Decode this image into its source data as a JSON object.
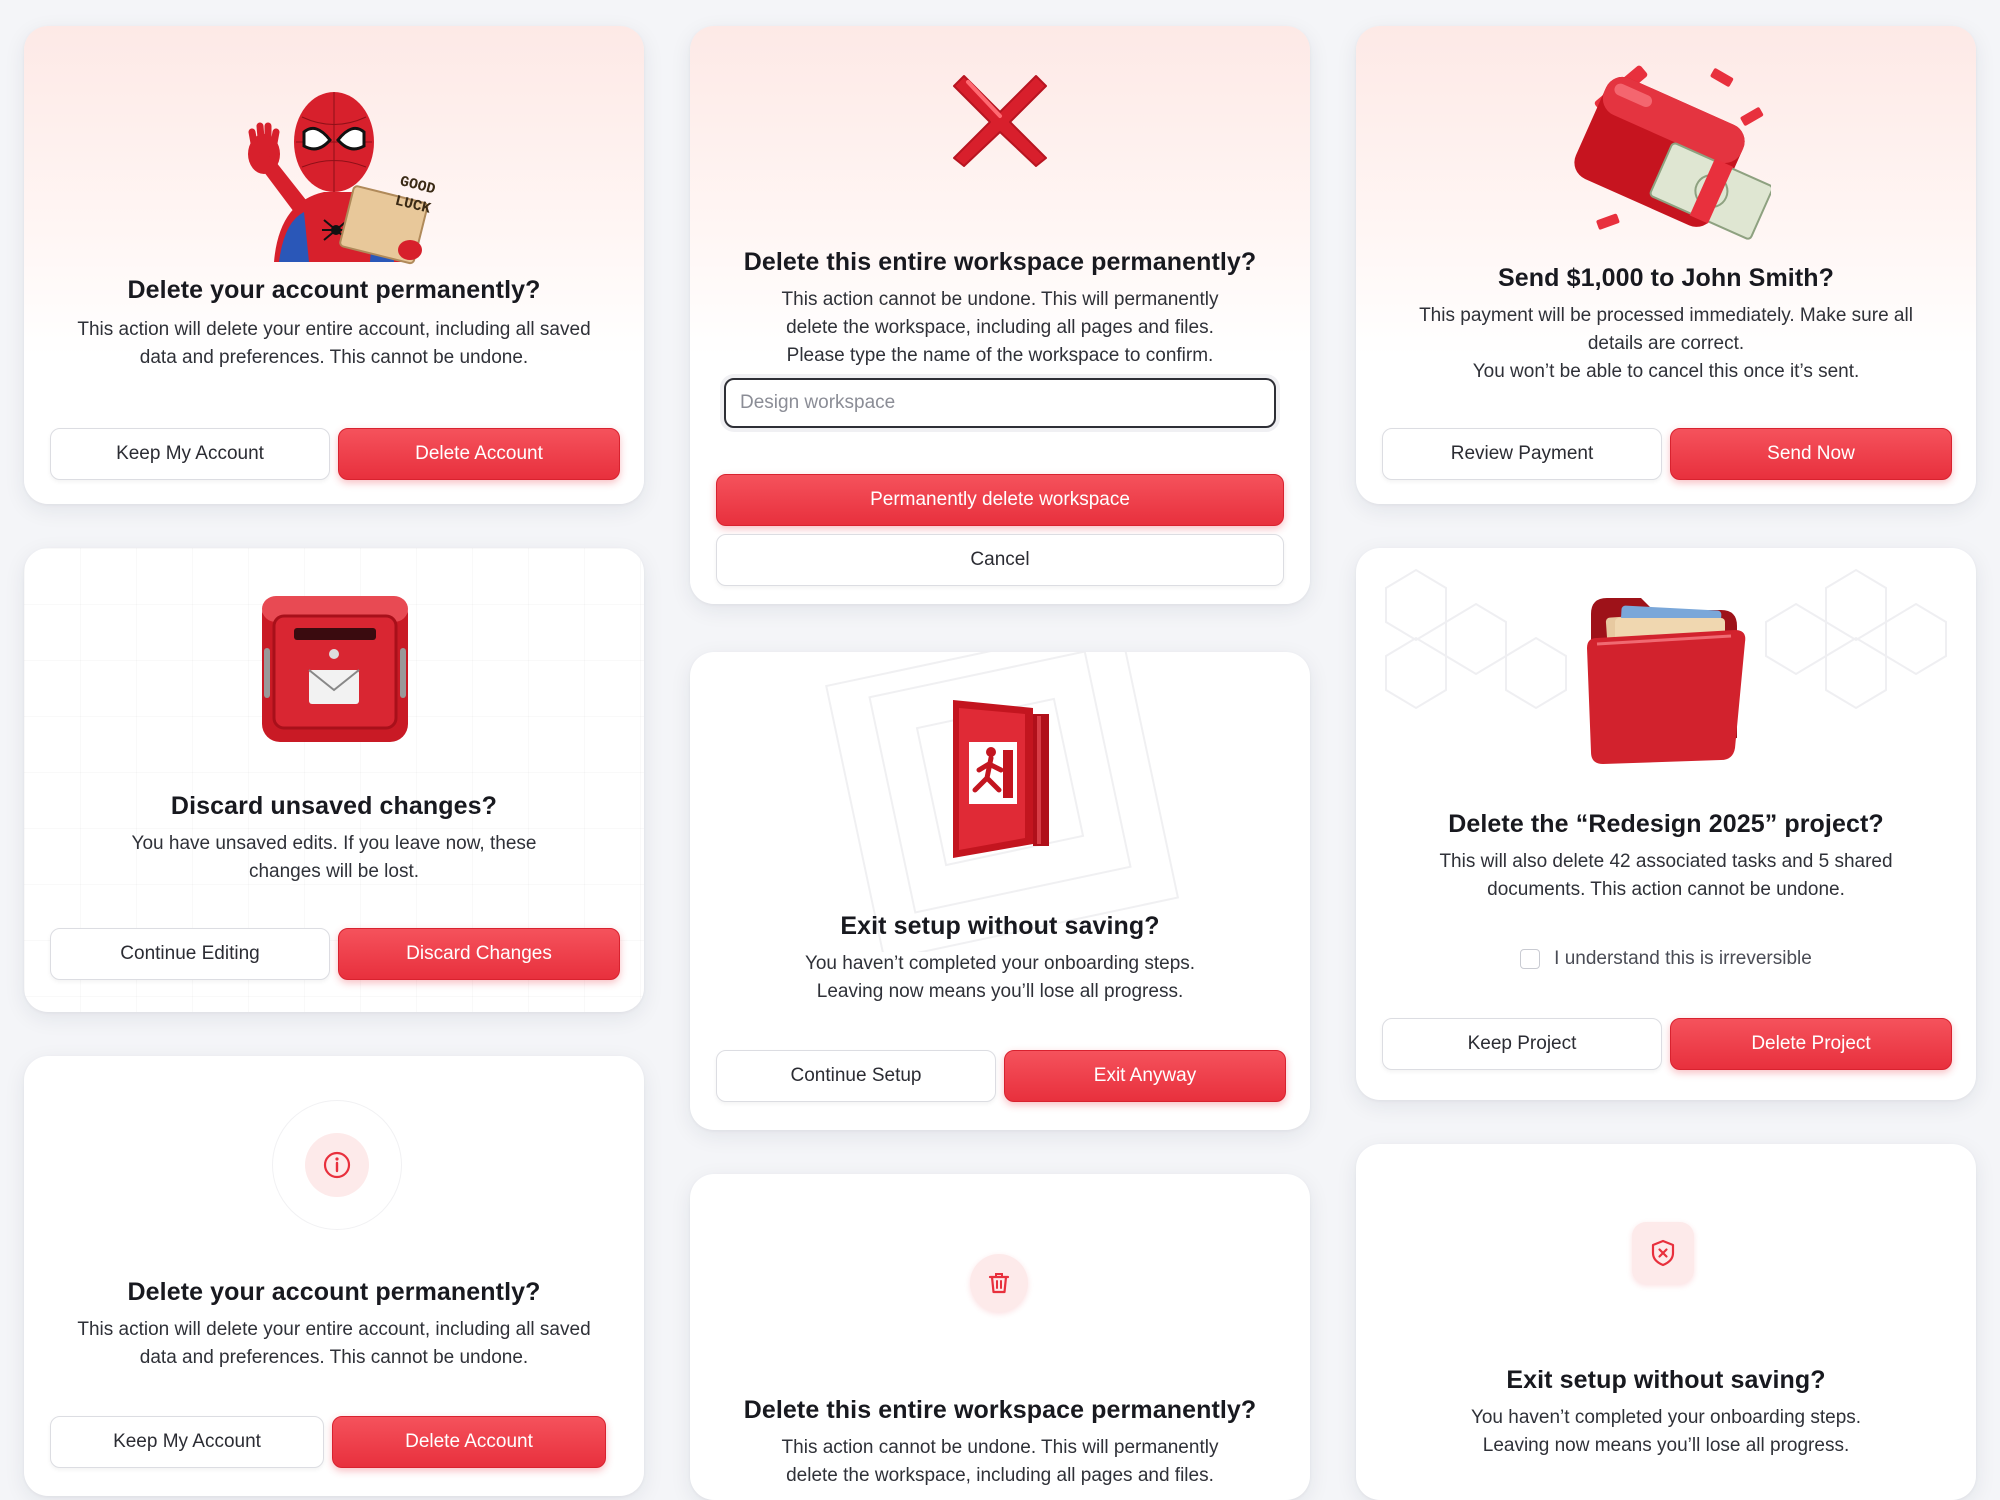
{
  "cards": {
    "delete_account_1": {
      "sign_text": "GOOD LUCK",
      "title": "Delete your account permanently?",
      "body": "This action will delete your entire account, including all saved data and preferences. This cannot be undone.",
      "secondary": "Keep My Account",
      "primary": "Delete Account"
    },
    "delete_workspace_1": {
      "title": "Delete this entire workspace permanently?",
      "body": "This action cannot be undone. This will permanently delete the workspace, including all pages and files. Please type the name of the workspace to confirm.",
      "input_placeholder": "Design workspace",
      "primary": "Permanently delete workspace",
      "secondary": "Cancel"
    },
    "send_payment": {
      "title": "Send $1,000 to John Smith?",
      "body_1": "This payment will be processed immediately. Make sure all details are correct.",
      "body_2": "You won’t be able to cancel this once it’s sent.",
      "secondary": "Review Payment",
      "primary": "Send Now"
    },
    "discard_changes": {
      "title": "Discard unsaved changes?",
      "body": "You have unsaved edits. If you leave now, these changes will be lost.",
      "secondary": "Continue Editing",
      "primary": "Discard Changes"
    },
    "exit_setup_1": {
      "title": "Exit setup without saving?",
      "body": "You haven’t completed your onboarding steps. Leaving now means you’ll lose all progress.",
      "secondary": "Continue Setup",
      "primary": "Exit Anyway"
    },
    "delete_project": {
      "title": "Delete the “Redesign 2025” project?",
      "body": "This will also delete 42 associated tasks and 5 shared documents. This action cannot be undone.",
      "checkbox_label": "I understand this is irreversible",
      "secondary": "Keep Project",
      "primary": "Delete Project"
    },
    "delete_account_2": {
      "title": "Delete your account permanently?",
      "body": "This action will delete your entire account, including all saved data and preferences. This cannot be undone.",
      "secondary": "Keep My Account",
      "primary": "Delete Account"
    },
    "delete_workspace_2": {
      "title": "Delete this entire workspace permanently?",
      "body": "This action cannot be undone. This will permanently delete the workspace, including all pages and files."
    },
    "exit_setup_2": {
      "title": "Exit setup without saving?",
      "body": "You haven’t completed your onboarding steps. Leaving now means you’ll lose all progress."
    }
  },
  "colors": {
    "accent": "#e8303d",
    "accent_light": "#fdeaea",
    "page_bg": "#f4f5f8"
  }
}
